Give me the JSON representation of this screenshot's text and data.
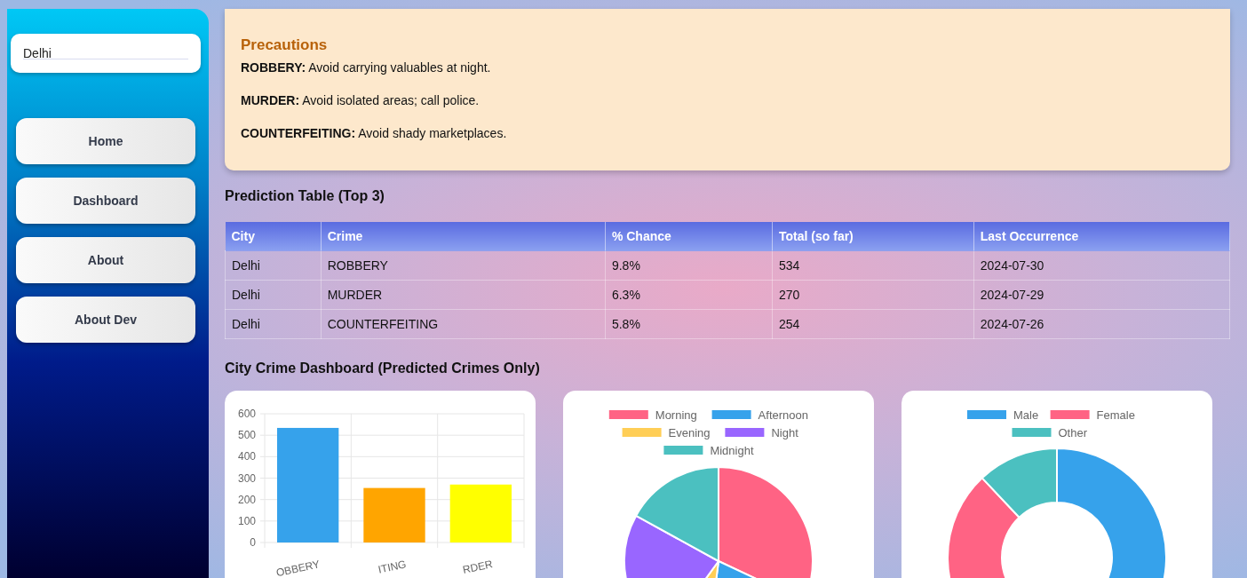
{
  "sidebar": {
    "city_field": {
      "value": "Delhi"
    },
    "nav": [
      {
        "label": "Home"
      },
      {
        "label": "Dashboard"
      },
      {
        "label": "About"
      },
      {
        "label": "About Dev"
      }
    ]
  },
  "precautions": {
    "title": "Precautions",
    "items": [
      {
        "crime": "ROBBERY:",
        "advice": "Avoid carrying valuables at night."
      },
      {
        "crime": "MURDER:",
        "advice": "Avoid isolated areas; call police."
      },
      {
        "crime": "COUNTERFEITING:",
        "advice": "Avoid shady marketplaces."
      }
    ]
  },
  "prediction_table": {
    "title": "Prediction Table (Top 3)",
    "columns": [
      "City",
      "Crime",
      "% Chance",
      "Total (so far)",
      "Last Occurrence"
    ],
    "rows": [
      [
        "Delhi",
        "ROBBERY",
        "9.8%",
        "534",
        "2024-07-30"
      ],
      [
        "Delhi",
        "MURDER",
        "6.3%",
        "270",
        "2024-07-29"
      ],
      [
        "Delhi",
        "COUNTERFEITING",
        "5.8%",
        "254",
        "2024-07-26"
      ]
    ]
  },
  "dashboard": {
    "title": "City Crime Dashboard (Predicted Crimes Only)",
    "charts": [
      {
        "chart_data": {
          "type": "bar",
          "categories": [
            "OBBERY",
            "ITING",
            "RDER"
          ],
          "values": [
            534,
            254,
            270
          ],
          "colors": [
            "#36a2eb",
            "#ffa500",
            "#ffff00"
          ],
          "grid": true,
          "ylim": [
            0,
            600
          ],
          "yticks": [
            0,
            100,
            200,
            300,
            400,
            500,
            600
          ]
        }
      },
      {
        "chart_data": {
          "type": "pie",
          "categories": [
            "Morning",
            "Afternoon",
            "Evening",
            "Night",
            "Midnight"
          ],
          "values": [
            32,
            20,
            8,
            23,
            17
          ],
          "legend": true,
          "colors": [
            "#ff6384",
            "#36a2eb",
            "#ffce56",
            "#9966ff",
            "#4bc0c0"
          ]
        }
      },
      {
        "chart_data": {
          "type": "donut",
          "categories": [
            "Male",
            "Female",
            "Other"
          ],
          "values": [
            35,
            53,
            12
          ],
          "legend": true,
          "colors": [
            "#36a2eb",
            "#ff6384",
            "#4bc0c0"
          ]
        }
      }
    ]
  }
}
